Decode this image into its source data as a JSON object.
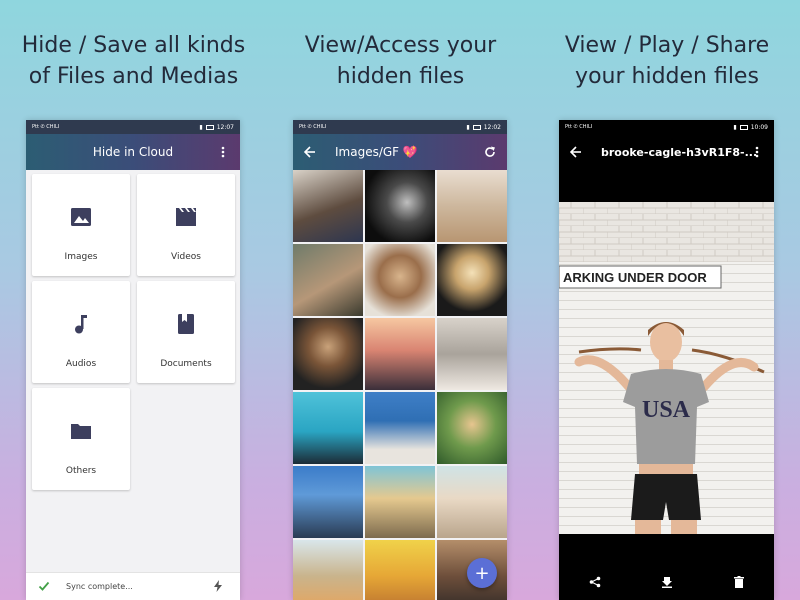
{
  "panels": [
    {
      "caption": [
        "Hide / Save all kinds",
        "of Files and Medias"
      ]
    },
    {
      "caption": [
        "View/Access your",
        "hidden files"
      ]
    },
    {
      "caption": [
        "View / Play / Share",
        "your hidden files"
      ]
    }
  ],
  "status": [
    {
      "carrier": "Ptt ✆ CHILI",
      "time": "12:07"
    },
    {
      "carrier": "Ptt ✆ CHILI",
      "time": "12:02"
    },
    {
      "carrier": "Ptt ✆ CHILI",
      "time": "10:09"
    }
  ],
  "home": {
    "title": "Hide in Cloud",
    "categories": [
      {
        "label": "Images",
        "icon": "image-icon"
      },
      {
        "label": "Videos",
        "icon": "video-icon"
      },
      {
        "label": "Audios",
        "icon": "music-icon"
      },
      {
        "label": "Documents",
        "icon": "book-icon"
      },
      {
        "label": "Others",
        "icon": "folder-icon"
      }
    ],
    "sync_text": "Sync complete..."
  },
  "gallery": {
    "title": "Images/GF 💖",
    "fab_label": "+"
  },
  "viewer": {
    "title": "brooke-cagle-h3vR1F8-...",
    "sign_text": "ARKING UNDER DOOR",
    "shirt_text": "USA"
  },
  "colors": {
    "appbar_start": "#2c5d73",
    "appbar_end": "#5b3a6e",
    "icon": "#3d3f5e",
    "sync_check": "#43a047",
    "fab": "#5b6fd6"
  }
}
